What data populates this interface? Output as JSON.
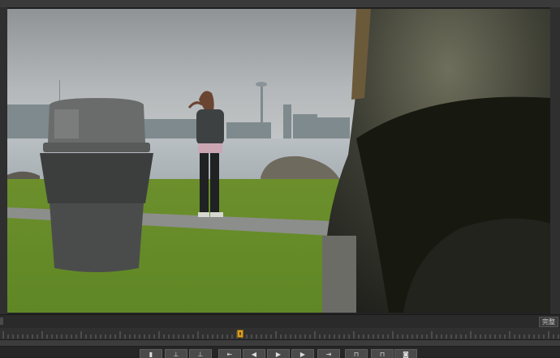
{
  "viewer": {
    "scene": "frame-preview"
  },
  "status_bar": {
    "fit_label": "完整"
  },
  "timeline": {
    "playhead_label": "playhead"
  },
  "controls": [
    {
      "name": "mark-in-button",
      "icon": "mark-in-icon",
      "glyph": "▮"
    },
    {
      "name": "mark-out-button",
      "icon": "mark-out-icon",
      "glyph": "⊥"
    },
    {
      "name": "add-marker-button",
      "icon": "marker-icon",
      "glyph": "⊥"
    },
    {
      "name": "go-to-in-button",
      "icon": "go-to-in-icon",
      "glyph": "⇤"
    },
    {
      "name": "step-back-button",
      "icon": "step-back-icon",
      "glyph": "◀"
    },
    {
      "name": "play-button",
      "icon": "play-icon",
      "glyph": "▶"
    },
    {
      "name": "step-forward-button",
      "icon": "step-forward-icon",
      "glyph": "▶"
    },
    {
      "name": "go-to-out-button",
      "icon": "go-to-out-icon",
      "glyph": "⇥"
    },
    {
      "name": "insert-button",
      "icon": "insert-icon",
      "glyph": "⊓"
    },
    {
      "name": "overwrite-button",
      "icon": "overwrite-icon",
      "glyph": "⊓"
    },
    {
      "name": "export-frame-button",
      "icon": "camera-icon",
      "glyph": "◙"
    }
  ],
  "colors": {
    "playhead": "#d8a021",
    "panel": "#232323",
    "button": "#4a4a4a"
  }
}
